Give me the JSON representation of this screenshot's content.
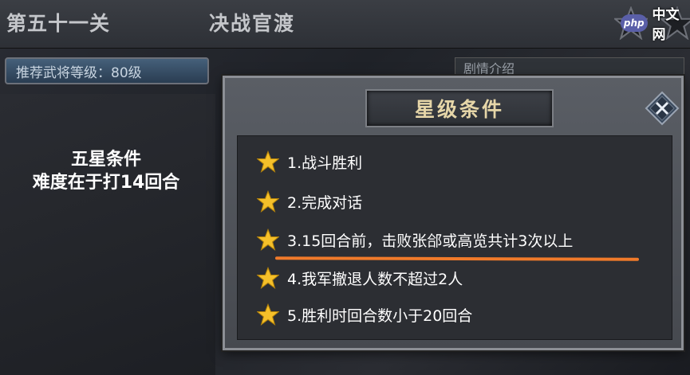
{
  "header": {
    "level_name": "第五十一关",
    "battle_name": "决战官渡",
    "star_icons": [
      "star-icon",
      "star-icon"
    ]
  },
  "watermark": {
    "logo_text": "php",
    "text": "中文网"
  },
  "recommended": {
    "text": "推荐武将等级：80级"
  },
  "left_note": {
    "line1": "五星条件",
    "line2": "难度在于打14回合"
  },
  "story_tab": {
    "label": "剧情介绍"
  },
  "dialog": {
    "title": "星级条件",
    "close_icon": "close-icon",
    "conditions": [
      {
        "text": "1.战斗胜利"
      },
      {
        "text": "2.完成对话"
      },
      {
        "text": "3.15回合前，击败张郃或高览共计3次以上"
      },
      {
        "text": "4.我军撤退人数不超过2人"
      },
      {
        "text": "5.胜利时回合数小于20回合"
      }
    ]
  },
  "colors": {
    "star": "#f5c02a",
    "highlight": "#f07a2a",
    "title": "#e6d6a8"
  }
}
